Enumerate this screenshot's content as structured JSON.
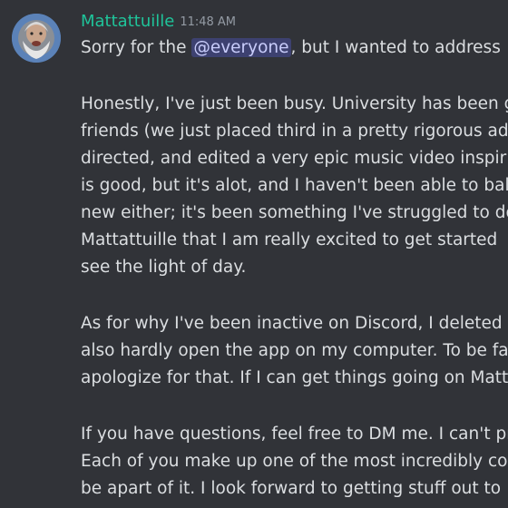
{
  "message": {
    "author": "Mattattuille",
    "timestamp": "11:48 AM",
    "avatar": "avatar-image",
    "colors": {
      "background": "#313338",
      "username": "#1fc49a",
      "text": "#dbdee1",
      "timestamp": "#949ba4",
      "mention_bg": "#3c4270",
      "mention_text": "#c9cdfb"
    },
    "para1": {
      "before": "Sorry for the ",
      "mention": "@everyone",
      "after": ", but I wanted to address"
    },
    "para2": [
      "Honestly, I've just been busy. University has been g",
      "friends (we just placed third in a pretty rigorous ad",
      "directed, and edited a very epic music video inspir",
      "is good, but it's alot, and I haven't been able to bal",
      "new either; it's been something I've struggled to do",
      "Mattattuille that I am really excited to get started",
      "see the light of day."
    ],
    "para3": [
      "As for why I've been inactive on Discord, I deleted i",
      "also hardly open the app on my computer. To be fa",
      "apologize for that. If I can get things going on Matt"
    ],
    "para4": [
      "If you have questions, feel free to DM me. I can't pr",
      "Each of you make up one of the most incredibly co",
      "be apart of it. I look forward to getting stuff out to"
    ]
  }
}
